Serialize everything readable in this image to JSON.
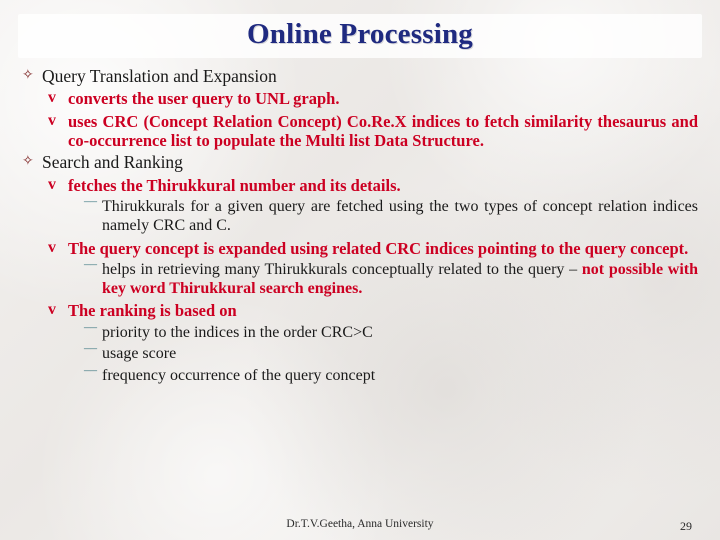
{
  "slide": {
    "title": "Online Processing",
    "footer_note": "Dr.T.V.Geetha, Anna University",
    "page_number": "29",
    "bullets": {
      "level1": "✧",
      "level2": "v",
      "level3": "¯¯"
    },
    "colors": {
      "title": "#1f2a80",
      "level1_text": "#1a1a1a",
      "level1_bullet": "#7b1f1f",
      "level2_text": "#cc0022",
      "level3_bullet": "#2f6f7a",
      "background": "#f0eeec"
    },
    "content": [
      {
        "id": "l1-query-translation",
        "level": 1,
        "text": "Query Translation and Expansion"
      },
      {
        "id": "l2-converts",
        "level": 2,
        "text": "converts the user query to UNL graph."
      },
      {
        "id": "l2-crc-indices",
        "level": 2,
        "text": "uses CRC (Concept Relation Concept) Co.Re.X indices to fetch similarity thesaurus and co-occurrence list to populate the Multi list Data Structure."
      },
      {
        "id": "l1-search-ranking",
        "level": 1,
        "text": "Search and Ranking"
      },
      {
        "id": "l2-fetches",
        "level": 2,
        "text": "fetches the Thirukkural number and its details."
      },
      {
        "id": "l3-thirukkurals-fetched",
        "level": 3,
        "text": "Thirukkurals for a given query are fetched using the two types of concept relation indices namely CRC and C."
      },
      {
        "id": "l2-query-expanded",
        "level": 2,
        "text": "The query concept is expanded using related CRC indices pointing to the query concept."
      },
      {
        "id": "l3-helps-retrieving-a",
        "level": 3,
        "text": "helps in retrieving many Thirukkurals conceptually related to the query – "
      },
      {
        "id": "l3-helps-retrieving-b",
        "level": 3,
        "text": "not possible with key word Thirukkural search engines."
      },
      {
        "id": "l2-ranking-based",
        "level": 2,
        "text": "The ranking is based on"
      },
      {
        "id": "l3-priority",
        "level": 3,
        "text": "priority to the indices in the order CRC>C"
      },
      {
        "id": "l3-usage-score",
        "level": 3,
        "text": "usage score"
      },
      {
        "id": "l3-frequency",
        "level": 3,
        "text": "frequency occurrence of the query concept"
      }
    ]
  }
}
